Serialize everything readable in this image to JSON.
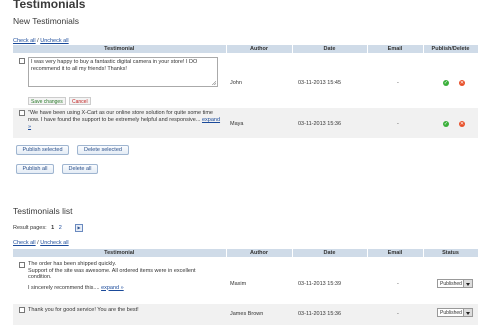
{
  "page": {
    "title": "Testimonials"
  },
  "new_section": {
    "title": "New Testimonials",
    "check_all": "Check all",
    "sep": "/",
    "uncheck_all": "Uncheck all",
    "columns": [
      "Testimonial",
      "Author",
      "Date",
      "Email",
      "Publish/Delete"
    ],
    "rows": [
      {
        "text": "I was very happy to buy a fantastic digital camera in your store! I DO recommend it to all my friends! Thanks!",
        "author": "John",
        "date": "03-11-2013 15:45",
        "email": "-",
        "editing": true,
        "save_label": "Save changes",
        "cancel_label": "Cancel"
      },
      {
        "text": "\"We have been using X-Cart as our online store solution for quite some time now. I have found the support to be extremely helpful and responsive...",
        "expand": "expand »",
        "author": "Maya",
        "date": "03-11-2013 15:36",
        "email": "-"
      }
    ],
    "buttons": {
      "publish_selected": "Publish selected",
      "delete_selected": "Delete selected",
      "publish_all": "Publish all",
      "delete_all": "Delete all"
    }
  },
  "list_section": {
    "title": "Testimonials list",
    "result_pages_label": "Result pages:",
    "pages": [
      "1",
      "2"
    ],
    "check_all": "Check all",
    "sep": "/",
    "uncheck_all": "Uncheck all",
    "columns": [
      "Testimonial",
      "Author",
      "Date",
      "Email",
      "Status"
    ],
    "rows": [
      {
        "line1": "The order has been shipped quickly.",
        "line2": "Support of the site was awesome. All ordered items were in excellent",
        "line3": "condition.",
        "line4": "I sincerely recommend this....",
        "expand": "expand »",
        "author": "Maxim",
        "date": "03-11-2013 15:39",
        "email": "-",
        "status": "Published"
      },
      {
        "line1": "Thank you for good service! You are the best!",
        "author": "James Brown",
        "date": "03-11-2013 15:36",
        "email": "-",
        "status": "Published"
      }
    ]
  },
  "colors": {
    "header_bg": "#cfdbe8",
    "link": "#1a4a9a",
    "publish_icon": "#3ab03a",
    "delete_icon": "#e8502a"
  }
}
